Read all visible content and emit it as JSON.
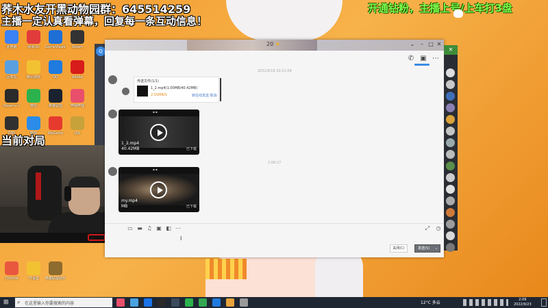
{
  "overlay": {
    "top_line": "荞木水友开黑动物园群：645514259",
    "sub_line": "主播一定认真看弹幕，回复每一条互动信息！",
    "right_line": "开通钻粉，主播上号/上车打3盘",
    "left_label": "当前对局"
  },
  "desktop_icons": [
    {
      "label": "此电脑",
      "color": "#3b82f6"
    },
    {
      "label": "网易UU",
      "color": "#e23b3b"
    },
    {
      "label": "GameViewer",
      "color": "#1d6fd6"
    },
    {
      "label": "Steam",
      "color": "#333333"
    },
    {
      "label": "回收站",
      "color": "#5aa0e0"
    },
    {
      "label": "腾讯游戏",
      "color": "#f2c233"
    },
    {
      "label": "QQ",
      "color": "#1f7be0"
    },
    {
      "label": "Adobe",
      "color": "#d81b1b"
    },
    {
      "label": "Steam++",
      "color": "#2a2a2a"
    },
    {
      "label": "微信",
      "color": "#2bb24c"
    },
    {
      "label": "英雄联盟",
      "color": "#1a2230"
    },
    {
      "label": "哔哩哔哩",
      "color": "#e94f6b"
    },
    {
      "label": "OBS",
      "color": "#303030"
    },
    {
      "label": "酷狗",
      "color": "#2a8ce8"
    },
    {
      "label": "WeGame",
      "color": "#e63a2e"
    },
    {
      "label": "LOL",
      "color": "#c7a13a"
    },
    {
      "label": "Chrome",
      "color": "#e9573f"
    },
    {
      "label": "YY语音",
      "color": "#f2c233"
    },
    {
      "label": "英雄联盟助手",
      "color": "#8e6b2e"
    }
  ],
  "chat": {
    "title": "20",
    "title_star": "★",
    "timestamp1": "2022/9/19 20:21:09",
    "timestamp2": "2:08:27",
    "file_card": {
      "header": "传送文件(1/1)",
      "name": "1_2.mp4(1.00MB/40.42MB)",
      "state": "2.55MB/S",
      "actions": "转在线发送  取消"
    },
    "video1": {
      "name": "1_2.mp4",
      "size": "40.42MB",
      "status": "已下载"
    },
    "video2": {
      "name": "my.mp4",
      "size": "MB",
      "status": "已下载"
    },
    "close_label": "关闭(C)",
    "send_label": "发送(S)",
    "send_arrow": "⌄"
  },
  "taskbar": {
    "search_placeholder": "在这里输入你要搜索的内容",
    "weather": "12°C 多云",
    "time": "2:09",
    "date": "2022/9/23"
  }
}
